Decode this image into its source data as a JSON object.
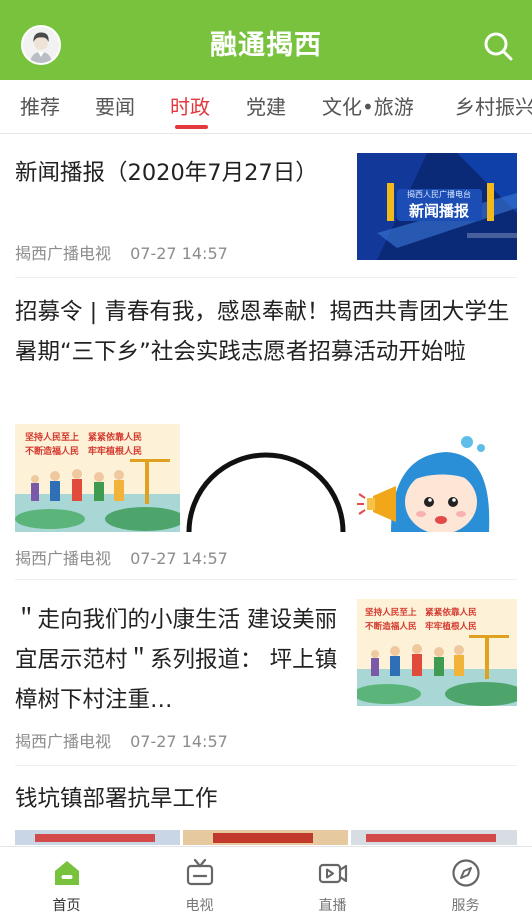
{
  "header": {
    "title": "融通揭西",
    "avatar_icon": "user-avatar-icon",
    "search_icon": "search-icon",
    "background": "#78c23e"
  },
  "tabs": [
    {
      "label": "推荐",
      "active": false
    },
    {
      "label": "要闻",
      "active": false
    },
    {
      "label": "时政",
      "active": true
    },
    {
      "label": "党建",
      "active": false
    },
    {
      "label": "文化•旅游",
      "active": false
    },
    {
      "label": "乡村振兴",
      "active": false
    }
  ],
  "accent_color": "#e3393c",
  "articles": [
    {
      "title": "新闻播报（2020年7月27日）",
      "source": "揭西广播电视",
      "time": "07-27 14:57",
      "thumb": {
        "station": "揭西人民广播电台",
        "caption": "新闻播报"
      }
    },
    {
      "title": "招募令 | 青春有我，感恩奉献！揭西共青团大学生暑期“三下乡”社会实践志愿者招募活动开始啦",
      "source": "揭西广播电视",
      "time": "07-27 14:57",
      "images": [
        {
          "line1": "坚持人民至上　紧紧依靠人民",
          "line2": "不断造福人民　牢牢植根人民"
        }
      ]
    },
    {
      "title": "＂走向我们的小康生活 建设美丽宜居示范村＂系列报道： 坪上镇樟树下村注重…",
      "source": "揭西广播电视",
      "time": "07-27 14:57",
      "thumb": {
        "line1": "坚持人民至上　紧紧依靠人民",
        "line2": "不断造福人民　牢牢植根人民"
      }
    },
    {
      "title": "钱坑镇部署抗旱工作"
    }
  ],
  "bottom_nav": [
    {
      "label": "首页",
      "icon": "home-icon",
      "active": true
    },
    {
      "label": "电视",
      "icon": "tv-icon",
      "active": false
    },
    {
      "label": "直播",
      "icon": "live-video-icon",
      "active": false
    },
    {
      "label": "服务",
      "icon": "compass-icon",
      "active": false
    }
  ],
  "nav_active_color": "#78c23e"
}
